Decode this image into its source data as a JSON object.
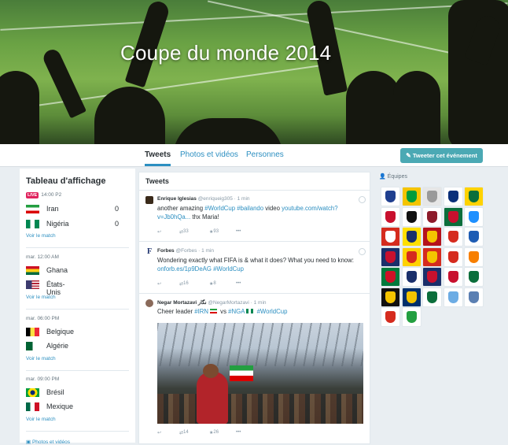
{
  "hero": {
    "title": "Coupe du monde 2014"
  },
  "nav": {
    "tabs": [
      {
        "label": "Tweets",
        "active": true
      },
      {
        "label": "Photos et vidéos",
        "active": false
      },
      {
        "label": "Personnes",
        "active": false
      }
    ],
    "tweet_event_button": "Tweeter cet événement"
  },
  "scoreboard": {
    "title": "Tableau d'affichage",
    "matches": [
      {
        "live": "LIVE",
        "time": "14:00 P2",
        "team1": "Iran",
        "score1": "0",
        "team2": "Nigéria",
        "score2": "0",
        "see": "Voir le match"
      },
      {
        "time": "mar. 12:00 AM",
        "team1": "Ghana",
        "team2": "États-Unis",
        "see": "Voir le match"
      },
      {
        "time": "mar. 06:00 PM",
        "team1": "Belgique",
        "team2": "Algérie",
        "see": "Voir le match"
      },
      {
        "time": "mar. 09:00 PM",
        "team1": "Brésil",
        "team2": "Mexique",
        "see": "Voir le match"
      }
    ],
    "footer_link": "Photos et vidéos"
  },
  "timeline": {
    "header": "Tweets",
    "tweets": [
      {
        "author": "Enrique Iglesias",
        "handle": "@enriqueig305 · 1 min",
        "text_plain": "another amazing ",
        "hashtag1": "#WorldCup",
        "hashtag2": "#bailando",
        "text_mid": " video ",
        "link": "youtube.com/watch?v=Jb0hQa...",
        "text_end": " thx Maria!",
        "retweets": "33",
        "favorites": "93"
      },
      {
        "author": "Forbes",
        "handle": "@Forbes · 1 min",
        "text_plain": "Wondering exactly what FIFA is & what it does? What you need to know: ",
        "link": "onforb.es/1p9DeAG",
        "hashtag1": "#WorldCup",
        "retweets": "16",
        "favorites": "8"
      },
      {
        "author": "Negar Mortazavi نگار",
        "handle": "@NegarMortazavi · 1 min",
        "text_plain": "Cheer leader ",
        "hashtag1": "#IRN",
        "text_mid": " vs ",
        "hashtag2": "#NGA",
        "hashtag3": "#WorldCup",
        "retweets": "14",
        "favorites": "26"
      }
    ]
  },
  "teams": {
    "label": "Équipes",
    "crest_colors": [
      [
        "#ffffff",
        "#1f3f8f"
      ],
      [
        "#f4c400",
        "#009c3b"
      ],
      [
        "#e6e6e6",
        "#9a9a9a"
      ],
      [
        "#ffffff",
        "#0a2f7a"
      ],
      [
        "#ffd200",
        "#0b6e3b"
      ],
      [
        "#ffffff",
        "#c8102e"
      ],
      [
        "#ffffff",
        "#111111"
      ],
      [
        "#ffffff",
        "#8d1b2b"
      ],
      [
        "#0b6e3b",
        "#c8102e"
      ],
      [
        "#ffffff",
        "#1e90ff"
      ],
      [
        "#d52b1e",
        "#ffffff"
      ],
      [
        "#ffdf00",
        "#1a2f6b"
      ],
      [
        "#b5121b",
        "#f4c400"
      ],
      [
        "#ffffff",
        "#d52b1e"
      ],
      [
        "#ffffff",
        "#1d5cb4"
      ],
      [
        "#1a2f6b",
        "#c8102e"
      ],
      [
        "#ffd200",
        "#d52b1e"
      ],
      [
        "#d52b1e",
        "#f4c400"
      ],
      [
        "#ffffff",
        "#d52b1e"
      ],
      [
        "#ffffff",
        "#f77f00"
      ],
      [
        "#007a3d",
        "#ce1126"
      ],
      [
        "#ffffff",
        "#1a2f6b"
      ],
      [
        "#1a2f6b",
        "#c8102e"
      ],
      [
        "#ffffff",
        "#c8102e"
      ],
      [
        "#ffffff",
        "#0b6e3b"
      ],
      [
        "#111111",
        "#f4c400"
      ],
      [
        "#002f6c",
        "#f4c400"
      ],
      [
        "#ffffff",
        "#0b6e3b"
      ],
      [
        "#ffffff",
        "#6cace4"
      ],
      [
        "#ffffff",
        "#5a7fb2"
      ],
      [
        "#ffffff",
        "#d52b1e"
      ],
      [
        "#ffffff",
        "#239f40"
      ]
    ]
  }
}
